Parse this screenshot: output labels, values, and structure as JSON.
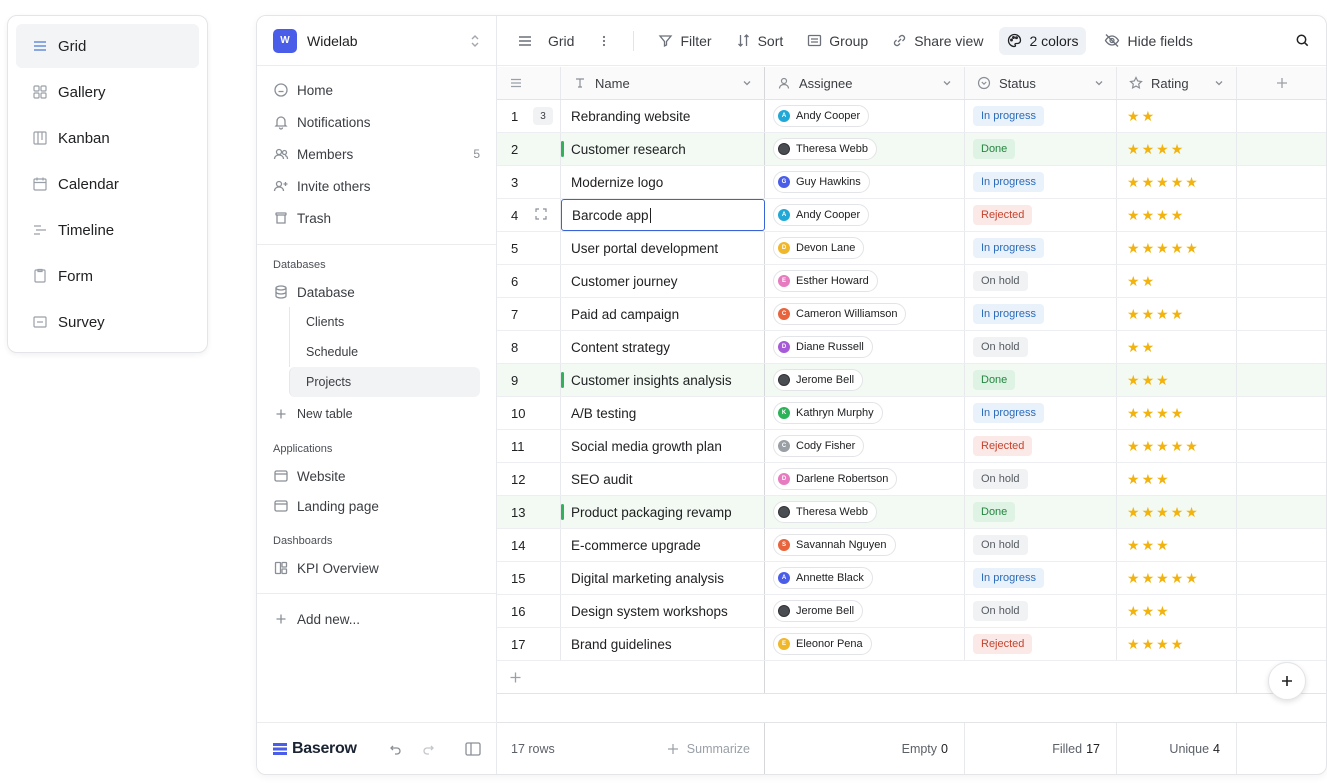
{
  "views": {
    "items": [
      {
        "label": "Grid",
        "icon": "grid-icon",
        "active": true
      },
      {
        "label": "Gallery",
        "icon": "gallery-icon"
      },
      {
        "label": "Kanban",
        "icon": "kanban-icon"
      },
      {
        "label": "Calendar",
        "icon": "calendar-icon"
      },
      {
        "label": "Timeline",
        "icon": "timeline-icon"
      },
      {
        "label": "Form",
        "icon": "form-icon"
      },
      {
        "label": "Survey",
        "icon": "survey-icon"
      }
    ]
  },
  "workspace": {
    "badge": "W",
    "name": "Widelab"
  },
  "nav": {
    "home": "Home",
    "notifications": "Notifications",
    "members": "Members",
    "members_count": "5",
    "invite": "Invite others",
    "trash": "Trash"
  },
  "databases": {
    "title": "Databases",
    "database": "Database",
    "tables": [
      "Clients",
      "Schedule",
      "Projects"
    ],
    "new_table": "New table"
  },
  "applications": {
    "title": "Applications",
    "items": [
      "Website",
      "Landing page"
    ]
  },
  "dashboards": {
    "title": "Dashboards",
    "items": [
      "KPI Overview"
    ]
  },
  "add_new": "Add new...",
  "brand": "Baserow",
  "toolbar": {
    "view": "Grid",
    "filter": "Filter",
    "sort": "Sort",
    "group": "Group",
    "share": "Share view",
    "colors": "2 colors",
    "hide": "Hide fields"
  },
  "columns": {
    "name": "Name",
    "assignee": "Assignee",
    "status": "Status",
    "rating": "Rating"
  },
  "rows": [
    {
      "n": "1",
      "name": "Rebranding website",
      "assignee": "Andy Cooper",
      "initial": "A",
      "color": "#21a8d6",
      "status": "In progress",
      "rating": 2,
      "count": "3"
    },
    {
      "n": "2",
      "name": "Customer research",
      "assignee": "Theresa Webb",
      "initial": "",
      "color": "#4a4d52",
      "status": "Done",
      "rating": 4
    },
    {
      "n": "3",
      "name": "Modernize logo",
      "assignee": "Guy Hawkins",
      "initial": "G",
      "color": "#4a5de8",
      "status": "In progress",
      "rating": 5
    },
    {
      "n": "4",
      "name": "Barcode app",
      "assignee": "Andy Cooper",
      "initial": "A",
      "color": "#21a8d6",
      "status": "Rejected",
      "rating": 4,
      "editing": true
    },
    {
      "n": "5",
      "name": "User portal development",
      "assignee": "Devon Lane",
      "initial": "D",
      "color": "#f1b72a",
      "status": "In progress",
      "rating": 5
    },
    {
      "n": "6",
      "name": "Customer journey",
      "assignee": "Esther Howard",
      "initial": "E",
      "color": "#e67bc0",
      "status": "On hold",
      "rating": 2
    },
    {
      "n": "7",
      "name": "Paid ad campaign",
      "assignee": "Cameron Williamson",
      "initial": "C",
      "color": "#e8643c",
      "status": "In progress",
      "rating": 4
    },
    {
      "n": "8",
      "name": "Content strategy",
      "assignee": "Diane Russell",
      "initial": "D",
      "color": "#a65ad8",
      "status": "On hold",
      "rating": 2
    },
    {
      "n": "9",
      "name": "Customer insights analysis",
      "assignee": "Jerome Bell",
      "initial": "",
      "color": "#4a4d52",
      "status": "Done",
      "rating": 3
    },
    {
      "n": "10",
      "name": "A/B testing",
      "assignee": "Kathryn Murphy",
      "initial": "K",
      "color": "#2cb35a",
      "status": "In progress",
      "rating": 4
    },
    {
      "n": "11",
      "name": "Social media growth plan",
      "assignee": "Cody Fisher",
      "initial": "C",
      "color": "#9a9ea5",
      "status": "Rejected",
      "rating": 5
    },
    {
      "n": "12",
      "name": "SEO audit",
      "assignee": "Darlene Robertson",
      "initial": "D",
      "color": "#e67bc0",
      "status": "On hold",
      "rating": 3
    },
    {
      "n": "13",
      "name": "Product packaging revamp",
      "assignee": "Theresa Webb",
      "initial": "",
      "color": "#4a4d52",
      "status": "Done",
      "rating": 5
    },
    {
      "n": "14",
      "name": "E-commerce upgrade",
      "assignee": "Savannah Nguyen",
      "initial": "S",
      "color": "#e8643c",
      "status": "On hold",
      "rating": 3
    },
    {
      "n": "15",
      "name": "Digital marketing analysis",
      "assignee": "Annette Black",
      "initial": "A",
      "color": "#4a5de8",
      "status": "In progress",
      "rating": 5
    },
    {
      "n": "16",
      "name": "Design system workshops",
      "assignee": "Jerome Bell",
      "initial": "",
      "color": "#4a4d52",
      "status": "On hold",
      "rating": 3
    },
    {
      "n": "17",
      "name": "Brand guidelines",
      "assignee": "Eleonor Pena",
      "initial": "E",
      "color": "#f1b72a",
      "status": "Rejected",
      "rating": 4
    }
  ],
  "footer": {
    "rows": "17 rows",
    "summarize": "Summarize",
    "empty_label": "Empty",
    "empty_val": "0",
    "filled_label": "Filled",
    "filled_val": "17",
    "unique_label": "Unique",
    "unique_val": "4"
  }
}
